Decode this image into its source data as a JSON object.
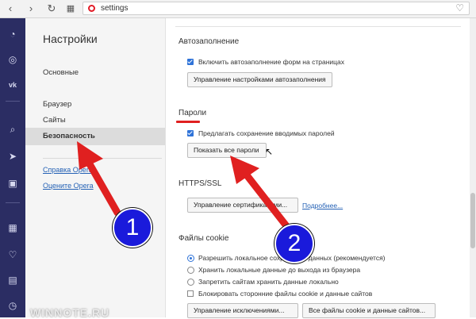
{
  "address_bar": {
    "url": "settings"
  },
  "settings_nav": {
    "title": "Настройки",
    "items": [
      {
        "label": "Основные",
        "active": false
      },
      {
        "label": "Браузер",
        "active": false
      },
      {
        "label": "Сайты",
        "active": false
      },
      {
        "label": "Безопасность",
        "active": true
      }
    ],
    "links": [
      "Справка Opera",
      "Оцените Opera"
    ]
  },
  "autofill": {
    "title": "Автозаполнение",
    "checkbox_label": "Включить автозаполнение форм на страницах",
    "button": "Управление настройками автозаполнения"
  },
  "passwords": {
    "title": "Пароли",
    "checkbox_label": "Предлагать сохранение вводимых паролей",
    "button": "Показать все пароли"
  },
  "https": {
    "title": "HTTPS/SSL",
    "button": "Управление сертификатами...",
    "link": "Подробнее..."
  },
  "cookies": {
    "title": "Файлы cookie",
    "options": [
      {
        "label": "Разрешить локальное сохранение данных (рекомендуется)",
        "selected": true
      },
      {
        "label": "Хранить локальные данные до выхода из браузера",
        "selected": false
      },
      {
        "label": "Запретить сайтам хранить данные локально",
        "selected": false
      }
    ],
    "block_label": "Блокировать сторонние файлы cookie и данные сайтов",
    "exceptions_button": "Управление исключениями...",
    "all_button": "Все файлы cookie и данные сайтов..."
  },
  "annotations": {
    "badge1": "1",
    "badge2": "2"
  },
  "watermark": "WINNOTE.RU",
  "colors": {
    "sidebar": "#2b2d63",
    "accent": "#2f73d8",
    "arrow": "#e02020",
    "badge": "#1a1adb"
  }
}
